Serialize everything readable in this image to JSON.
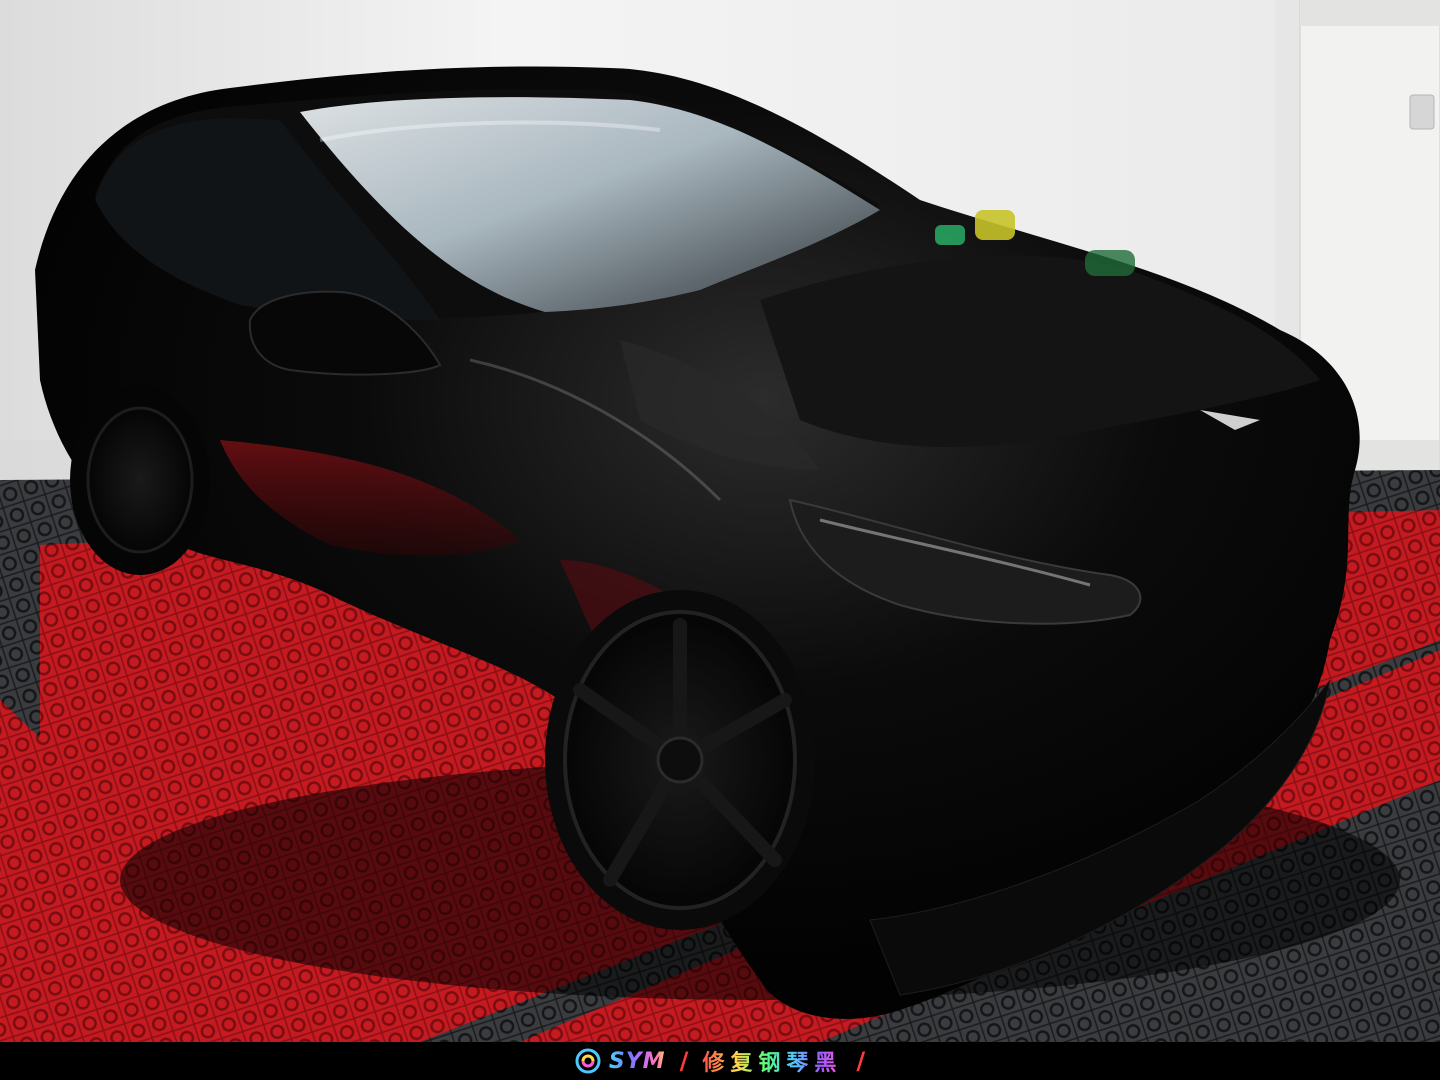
{
  "photo": {
    "subject": "black-suv",
    "colors": {
      "wall": "#f1f1f1",
      "floor_red": "#c41a20",
      "floor_dark": "#2a2c2e",
      "car_body": "#050505",
      "bar": "#000000"
    }
  },
  "caption": {
    "brand_icon": "brand-logo-icon",
    "brand_text": "SYM",
    "separator_left": "/",
    "slogan": "修复钢琴黑",
    "separator_right": "/"
  }
}
